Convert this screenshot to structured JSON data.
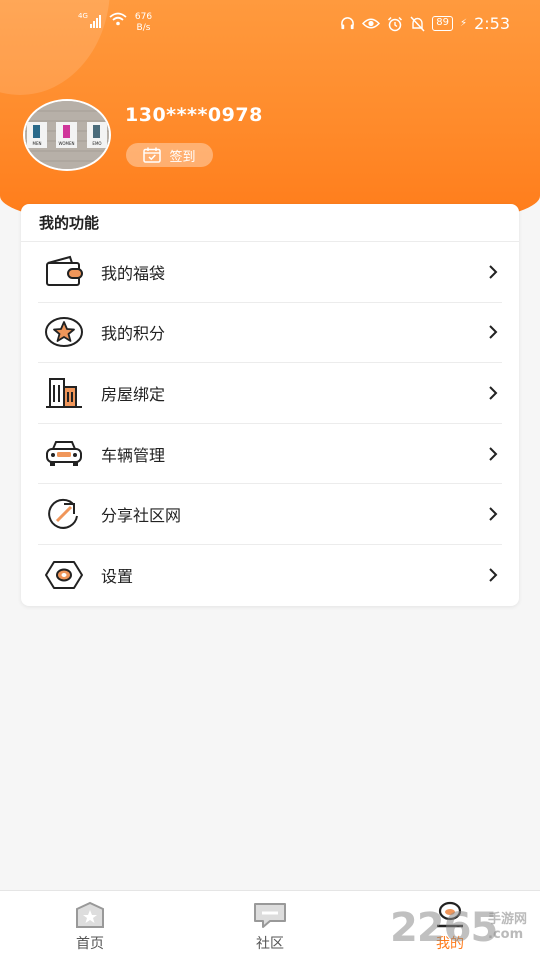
{
  "status_bar": {
    "network": "4G",
    "speed_value": "676",
    "speed_unit": "B/s",
    "battery": "89",
    "time": "2:53"
  },
  "profile": {
    "phone": "130****0978",
    "checkin_label": "签到",
    "avatar_signs": [
      "MEN",
      "WOMEN",
      "EMO"
    ]
  },
  "functions": {
    "title": "我的功能",
    "items": [
      {
        "label": "我的福袋",
        "icon": "wallet-icon"
      },
      {
        "label": "我的积分",
        "icon": "star-points-icon"
      },
      {
        "label": "房屋绑定",
        "icon": "building-icon"
      },
      {
        "label": "车辆管理",
        "icon": "car-icon"
      },
      {
        "label": "分享社区网",
        "icon": "share-icon"
      },
      {
        "label": "设置",
        "icon": "settings-icon"
      }
    ]
  },
  "tabbar": {
    "tabs": [
      {
        "label": "首页",
        "icon": "home-icon"
      },
      {
        "label": "社区",
        "icon": "community-icon"
      },
      {
        "label": "我的",
        "icon": "profile-icon",
        "active": true
      }
    ]
  },
  "watermark": {
    "main": "2265",
    "line1": "手游网",
    "line2": ".com"
  },
  "colors": {
    "accent": "#ff7a18",
    "icon_orange": "#f0965a",
    "text": "#222222"
  }
}
